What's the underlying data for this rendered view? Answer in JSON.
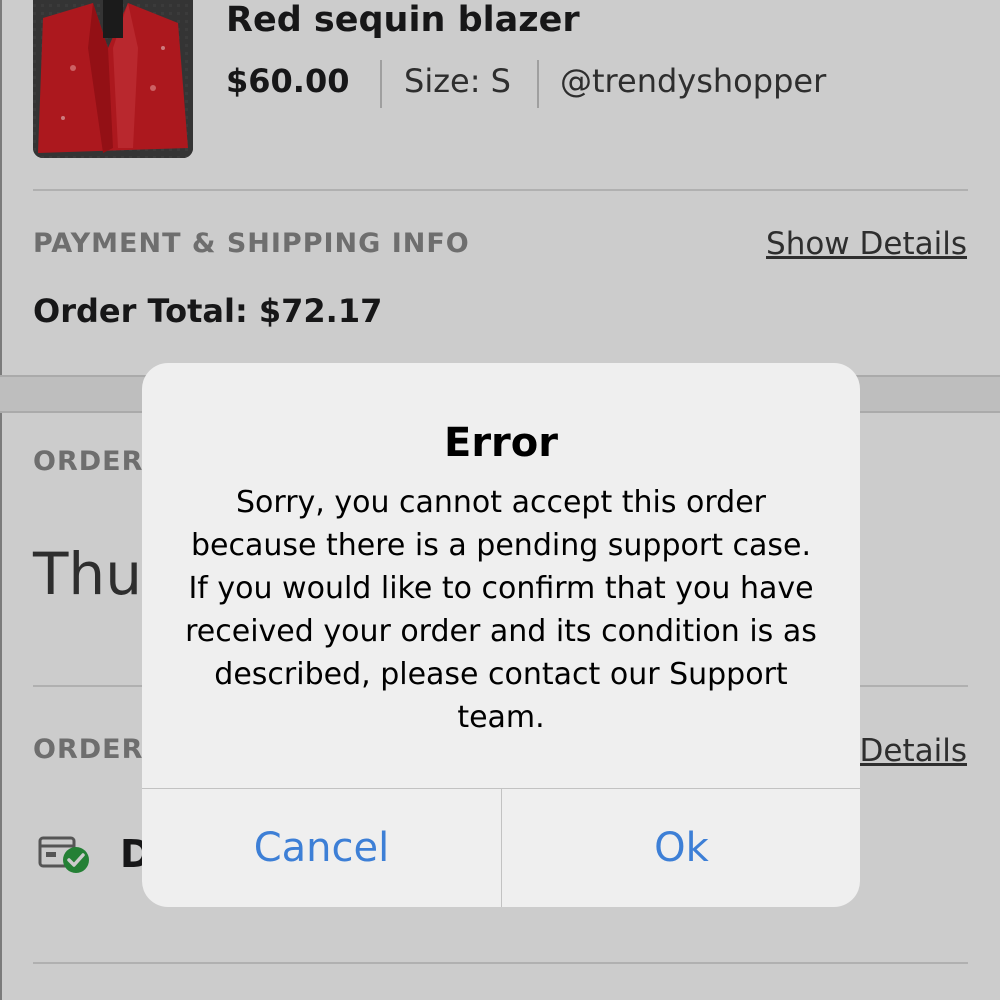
{
  "product": {
    "title": "Red sequin blazer",
    "price": "$60.00",
    "size": "Size: S",
    "seller": "@trendyshopper",
    "image_icon": "red-sequin-blazer-photo"
  },
  "payment": {
    "heading": "PAYMENT & SHIPPING INFO",
    "show_details": "Show Details",
    "order_total": "Order Total: $72.17"
  },
  "order_section": {
    "heading_partial": "ORDER",
    "date_partial": "Thu"
  },
  "order_status_section": {
    "heading_partial": "ORDER",
    "details_partial": "Details",
    "status_partial": "D",
    "status_icon": "package-delivered-icon"
  },
  "dialog": {
    "title": "Error",
    "message": "Sorry, you cannot accept this order because there is a pending support case. If you would like to confirm that you have received your order and its condition is as described, please contact our Support team.",
    "cancel_label": "Cancel",
    "ok_label": "Ok"
  },
  "colors": {
    "button_blue": "#3d7fd6",
    "check_green": "#2ea043",
    "blazer_red": "#d81f26"
  }
}
